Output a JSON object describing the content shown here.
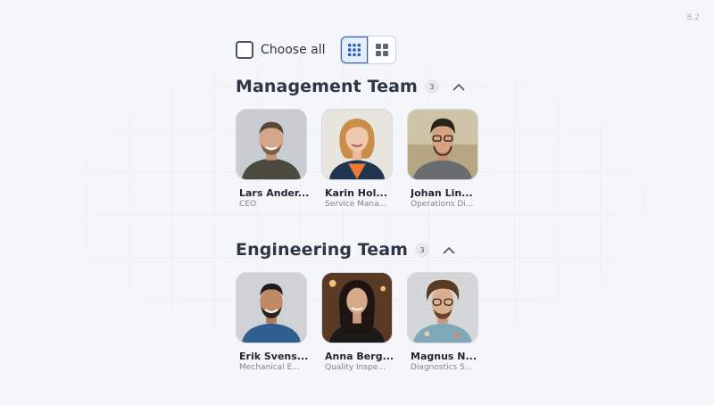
{
  "version": "8.2",
  "toolbar": {
    "choose_all_label": "Choose all",
    "views": [
      {
        "name": "grid-small",
        "active": true
      },
      {
        "name": "grid-large",
        "active": false
      }
    ]
  },
  "colors": {
    "accent": "#2b5fb4",
    "text": "#2d3748",
    "muted": "#7a8494",
    "background": "#f4f6f9"
  },
  "teams": [
    {
      "title": "Management Team",
      "count": "3",
      "collapse_icon": "chevron-up-icon",
      "members": [
        {
          "name": "Lars Ander...",
          "role": "CEO"
        },
        {
          "name": "Karin Hol...",
          "role": "Service Mana..."
        },
        {
          "name": "Johan Lin...",
          "role": "Operations Di..."
        }
      ]
    },
    {
      "title": "Engineering Team",
      "count": "3",
      "collapse_icon": "chevron-up-icon",
      "members": [
        {
          "name": "Erik Svens...",
          "role": "Mechanical E..."
        },
        {
          "name": "Anna Berg...",
          "role": "Quality Inspe..."
        },
        {
          "name": "Magnus N...",
          "role": "Diagnostics S..."
        }
      ]
    }
  ]
}
